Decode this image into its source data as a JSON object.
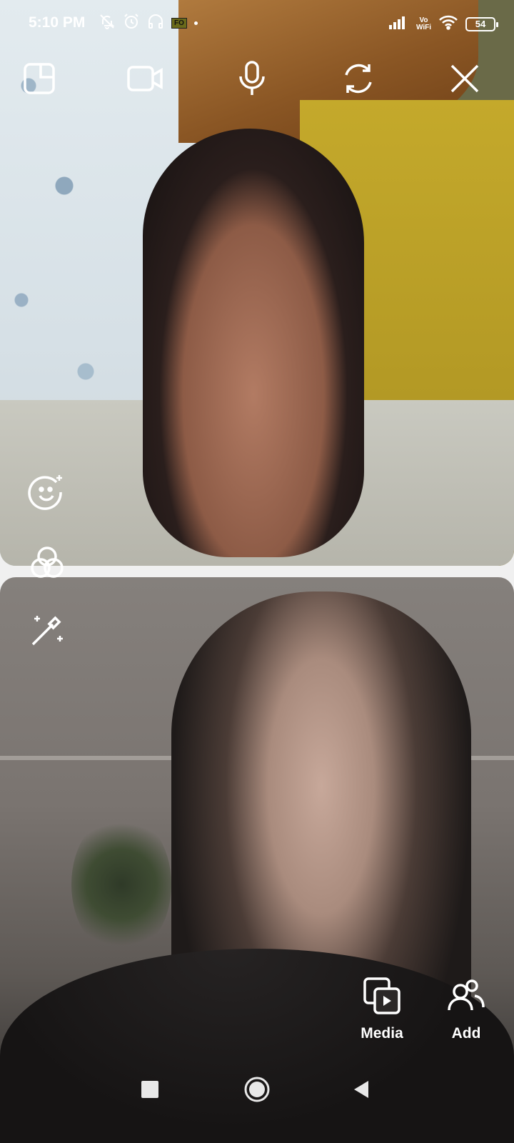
{
  "status_bar": {
    "time": "5:10 PM",
    "badge": "FO",
    "network": "Vo WiFi",
    "vowifi_top": "Vo",
    "vowifi_bottom": "WiFi",
    "battery": "54",
    "icons_left": [
      "mute-bell-icon",
      "alarm-icon",
      "headphones-icon",
      "fo-badge",
      "dot"
    ],
    "icons_right": [
      "signal-icon",
      "vowifi-icon",
      "wifi-icon",
      "battery-icon"
    ]
  },
  "call_controls": {
    "icons": [
      "layout-icon",
      "video-camera-icon",
      "microphone-icon",
      "flip-camera-icon",
      "close-icon"
    ]
  },
  "side_tools": {
    "icons": [
      "face-effects-icon",
      "filters-icon",
      "magic-wand-icon"
    ]
  },
  "actions": {
    "media_label": "Media",
    "add_label": "Add"
  },
  "nav": {
    "icons": [
      "recent-apps-icon",
      "home-icon",
      "back-icon"
    ]
  },
  "colors": {
    "icon": "#ffffff",
    "top_wall_right": "#b49a25",
    "bottom_tile_bg": "#7a7470"
  }
}
